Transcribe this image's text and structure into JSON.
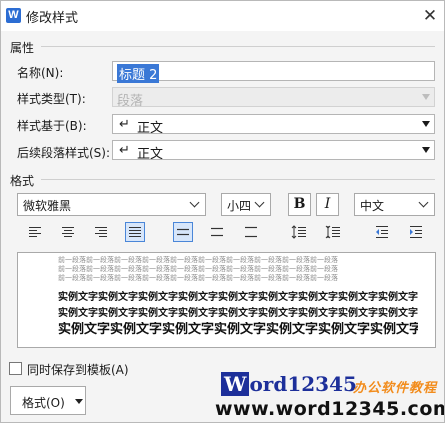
{
  "window": {
    "title": "修改样式",
    "app_icon": "W"
  },
  "properties": {
    "heading": "属性",
    "name_label": "名称(N):",
    "name_value": "标题 2",
    "style_type_label": "样式类型(T):",
    "style_type_value": "段落",
    "based_on_label": "样式基于(B):",
    "based_on_value": "正文",
    "following_label": "后续段落样式(S):",
    "following_value": "正文"
  },
  "format": {
    "heading": "格式",
    "font": "微软雅黑",
    "size": "小四",
    "bold_label": "B",
    "italic_label": "I",
    "script": "中文"
  },
  "alignment_buttons": [
    "align-left-icon",
    "align-center-icon",
    "align-right-icon",
    "align-justify-icon",
    "single-spacing-icon",
    "one-half-spacing-icon",
    "double-spacing-icon",
    "increase-paragraph-spacing-icon",
    "decrease-paragraph-spacing-icon",
    "decrease-indent-icon",
    "increase-indent-icon"
  ],
  "preview": {
    "previous_line": "前一段落前一段落前一段落前一段落前一段落前一段落前一段落前一段落前一段落前一段落",
    "sample_line": "实例文字实例文字实例文字实例文字实例文字实例文字实例文字实例文字实例文字实例文字"
  },
  "bottom": {
    "save_to_template_label": "同时保存到模板(A)",
    "format_button_label": "格式(O)"
  },
  "watermark": {
    "logo_initial": "W",
    "logo_rest": "ord12345",
    "tagline": "办公软件教程",
    "url": "www.word12345.com"
  },
  "colors": {
    "accent": "#3a78d6",
    "watermark_blue": "#1d2f9a",
    "watermark_orange": "#f28c1c"
  }
}
